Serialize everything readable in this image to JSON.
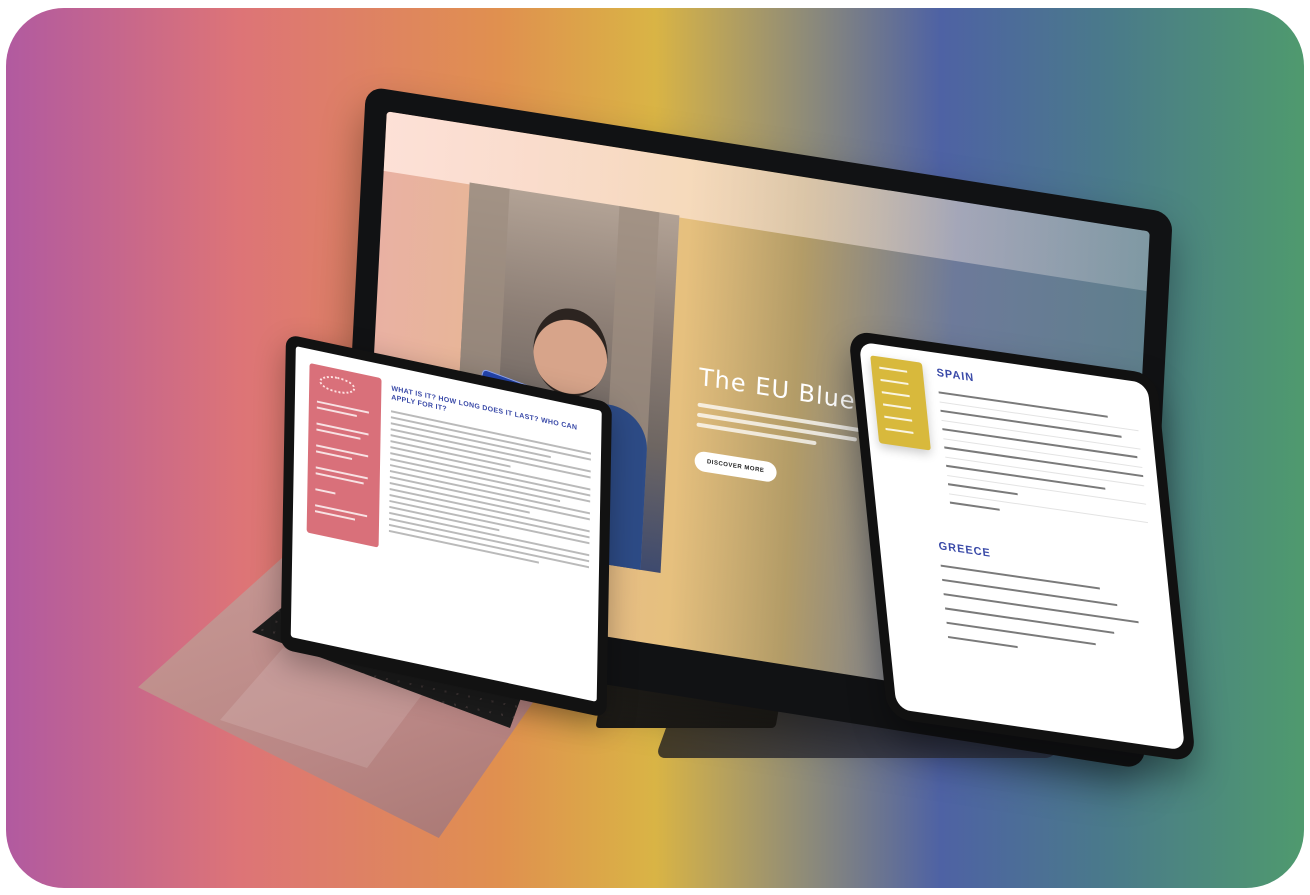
{
  "desktop": {
    "hero_title": "The EU Blue Ca",
    "hero_button": "DISCOVER MORE"
  },
  "laptop": {
    "article_title": "WHAT IS IT? HOW LONG DOES IT LAST? WHO CAN APPLY FOR IT?"
  },
  "tablet": {
    "section_1": "SPAIN",
    "section_2": "GREECE"
  }
}
